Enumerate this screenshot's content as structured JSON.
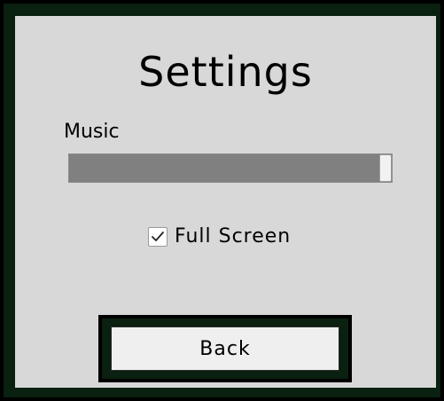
{
  "settings": {
    "title": "Settings",
    "music_label": "Music",
    "music_volume": 1.0,
    "fullscreen_label": "Full Screen",
    "fullscreen_checked": true,
    "back_label": "Back"
  },
  "colors": {
    "panel_bg": "#d8d8d8",
    "frame_dark_green": "#0a2010",
    "slider_fill": "#808080",
    "button_bg": "#efefef"
  }
}
